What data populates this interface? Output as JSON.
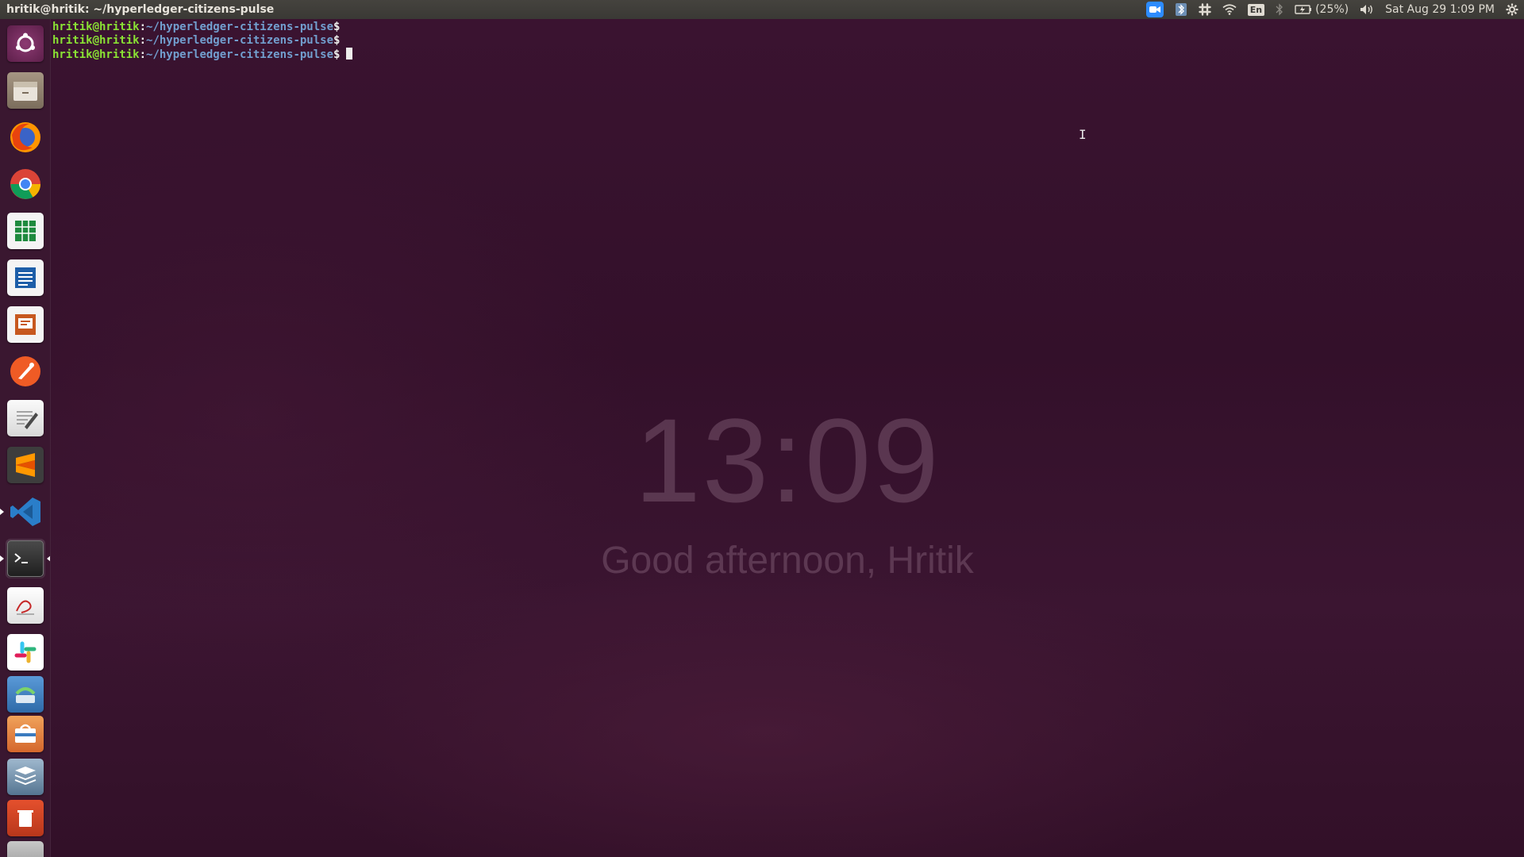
{
  "top_panel": {
    "window_title": "hritik@hritik: ~/hyperledger-citizens-pulse",
    "tray": {
      "keyboard_layout": "En",
      "battery": "(25%)",
      "datetime": "Sat Aug 29  1:09 PM"
    }
  },
  "launcher": {
    "items": [
      {
        "name": "ubuntu-dash-icon",
        "color": "#7a2a5e"
      },
      {
        "name": "files-icon",
        "color": "#8a7d6d"
      },
      {
        "name": "firefox-icon",
        "color": "#e66000"
      },
      {
        "name": "chrome-icon",
        "color": "#4285f4"
      },
      {
        "name": "libreoffice-calc-icon",
        "color": "#1e8a3e"
      },
      {
        "name": "libreoffice-writer-icon",
        "color": "#1d5ea8"
      },
      {
        "name": "libreoffice-impress-icon",
        "color": "#c7581f"
      },
      {
        "name": "postman-icon",
        "color": "#ef5b25"
      },
      {
        "name": "text-editor-icon",
        "color": "#d9d9d9"
      },
      {
        "name": "sublime-text-icon",
        "color": "#4a4a4a"
      },
      {
        "name": "vscode-icon",
        "color": "#2a7ec9"
      },
      {
        "name": "terminal-icon",
        "color": "#2e2e2e"
      },
      {
        "name": "document-viewer-icon",
        "color": "#e8e8e8"
      },
      {
        "name": "slack-icon",
        "color": "#ffffff"
      },
      {
        "name": "software-updater-icon",
        "color": "#3b7bbf"
      },
      {
        "name": "software-center-icon",
        "color": "#4f8dd2"
      },
      {
        "name": "stack-icon",
        "color": "#6f8fa8"
      }
    ]
  },
  "terminal": {
    "user_host": "hritik@hritik",
    "separator": ":",
    "path": "~/hyperledger-citizens-pulse",
    "prompt_symbol": "$",
    "lines": 3
  },
  "background_tab": {
    "clock": "13:09",
    "greeting": "Good afternoon, Hritik"
  }
}
